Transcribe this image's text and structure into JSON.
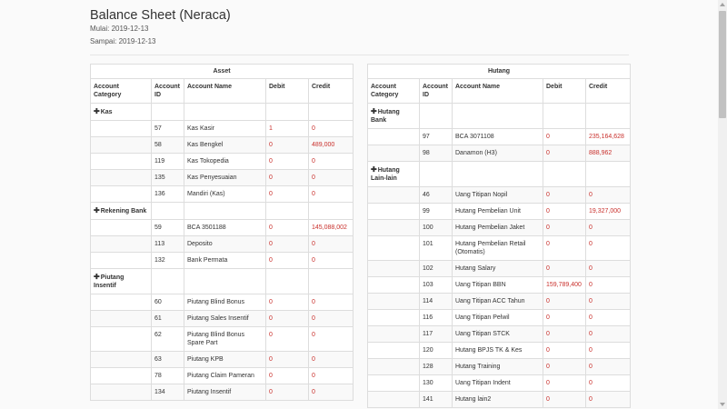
{
  "page": {
    "title": "Balance Sheet (Neraca)",
    "start": "Mulai: 2019-12-13",
    "end": "Sampai: 2019-12-13"
  },
  "columns": [
    "Account Category",
    "Account ID",
    "Account Name",
    "Debit",
    "Credit"
  ],
  "asset": {
    "heading": "Asset",
    "rows": [
      {
        "type": "cat",
        "category": "Kas"
      },
      {
        "id": "57",
        "name": "Kas Kasir",
        "debit": "1",
        "credit": "0"
      },
      {
        "id": "58",
        "name": "Kas Bengkel",
        "debit": "0",
        "credit": "489,000"
      },
      {
        "id": "119",
        "name": "Kas Tokopedia",
        "debit": "0",
        "credit": "0"
      },
      {
        "id": "135",
        "name": "Kas Penyesuaian",
        "debit": "0",
        "credit": "0"
      },
      {
        "id": "136",
        "name": "Mandiri (Kas)",
        "debit": "0",
        "credit": "0"
      },
      {
        "type": "cat",
        "category": "Rekening Bank"
      },
      {
        "id": "59",
        "name": "BCA 3501188",
        "debit": "0",
        "credit": "145,088,002"
      },
      {
        "id": "113",
        "name": "Deposito",
        "debit": "0",
        "credit": "0"
      },
      {
        "id": "132",
        "name": "Bank Permata",
        "debit": "0",
        "credit": "0"
      },
      {
        "type": "cat",
        "category": "Piutang Insentif"
      },
      {
        "id": "60",
        "name": "Piutang Blind Bonus",
        "debit": "0",
        "credit": "0"
      },
      {
        "id": "61",
        "name": "Piutang Sales Insentif",
        "debit": "0",
        "credit": "0"
      },
      {
        "id": "62",
        "name": "Piutang Blind Bonus Spare Part",
        "debit": "0",
        "credit": "0"
      },
      {
        "id": "63",
        "name": "Piutang KPB",
        "debit": "0",
        "credit": "0"
      },
      {
        "id": "78",
        "name": "Piutang Claim Pameran",
        "debit": "0",
        "credit": "0"
      },
      {
        "id": "134",
        "name": "Piutang Insentif",
        "debit": "0",
        "credit": "0"
      }
    ]
  },
  "hutang": {
    "heading": "Hutang",
    "rows": [
      {
        "type": "cat",
        "category": "Hutang Bank"
      },
      {
        "id": "97",
        "name": "BCA 3071108",
        "debit": "0",
        "credit": "235,164,628"
      },
      {
        "id": "98",
        "name": "Danamon (H3)",
        "debit": "0",
        "credit": "888,962"
      },
      {
        "type": "cat",
        "category": "Hutang Lain-lain"
      },
      {
        "id": "46",
        "name": "Uang Titipan Nopil",
        "debit": "0",
        "credit": "0"
      },
      {
        "id": "99",
        "name": "Hutang Pembelian Unit",
        "debit": "0",
        "credit": "19,327,000"
      },
      {
        "id": "100",
        "name": "Hutang Pembelian Jaket",
        "debit": "0",
        "credit": "0"
      },
      {
        "id": "101",
        "name": "Hutang Pembelian Retail (Otomatis)",
        "debit": "0",
        "credit": "0"
      },
      {
        "id": "102",
        "name": "Hutang Salary",
        "debit": "0",
        "credit": "0"
      },
      {
        "id": "103",
        "name": "Uang Titipan BBN",
        "debit": "159,789,400",
        "credit": "0"
      },
      {
        "id": "114",
        "name": "Uang Titipan ACC Tahun",
        "debit": "0",
        "credit": "0"
      },
      {
        "id": "116",
        "name": "Uang Titipan Pelwil",
        "debit": "0",
        "credit": "0"
      },
      {
        "id": "117",
        "name": "Uang Titipan STCK",
        "debit": "0",
        "credit": "0"
      },
      {
        "id": "120",
        "name": "Hutang BPJS TK & Kes",
        "debit": "0",
        "credit": "0"
      },
      {
        "id": "128",
        "name": "Hutang Training",
        "debit": "0",
        "credit": "0"
      },
      {
        "id": "130",
        "name": "Uang Titipan Indent",
        "debit": "0",
        "credit": "0"
      },
      {
        "id": "141",
        "name": "Hutang lain2",
        "debit": "0",
        "credit": "0"
      }
    ]
  },
  "colors": {
    "value": "#c9302c",
    "border": "#dddddd"
  },
  "icons": {
    "expand": "plus-icon"
  }
}
